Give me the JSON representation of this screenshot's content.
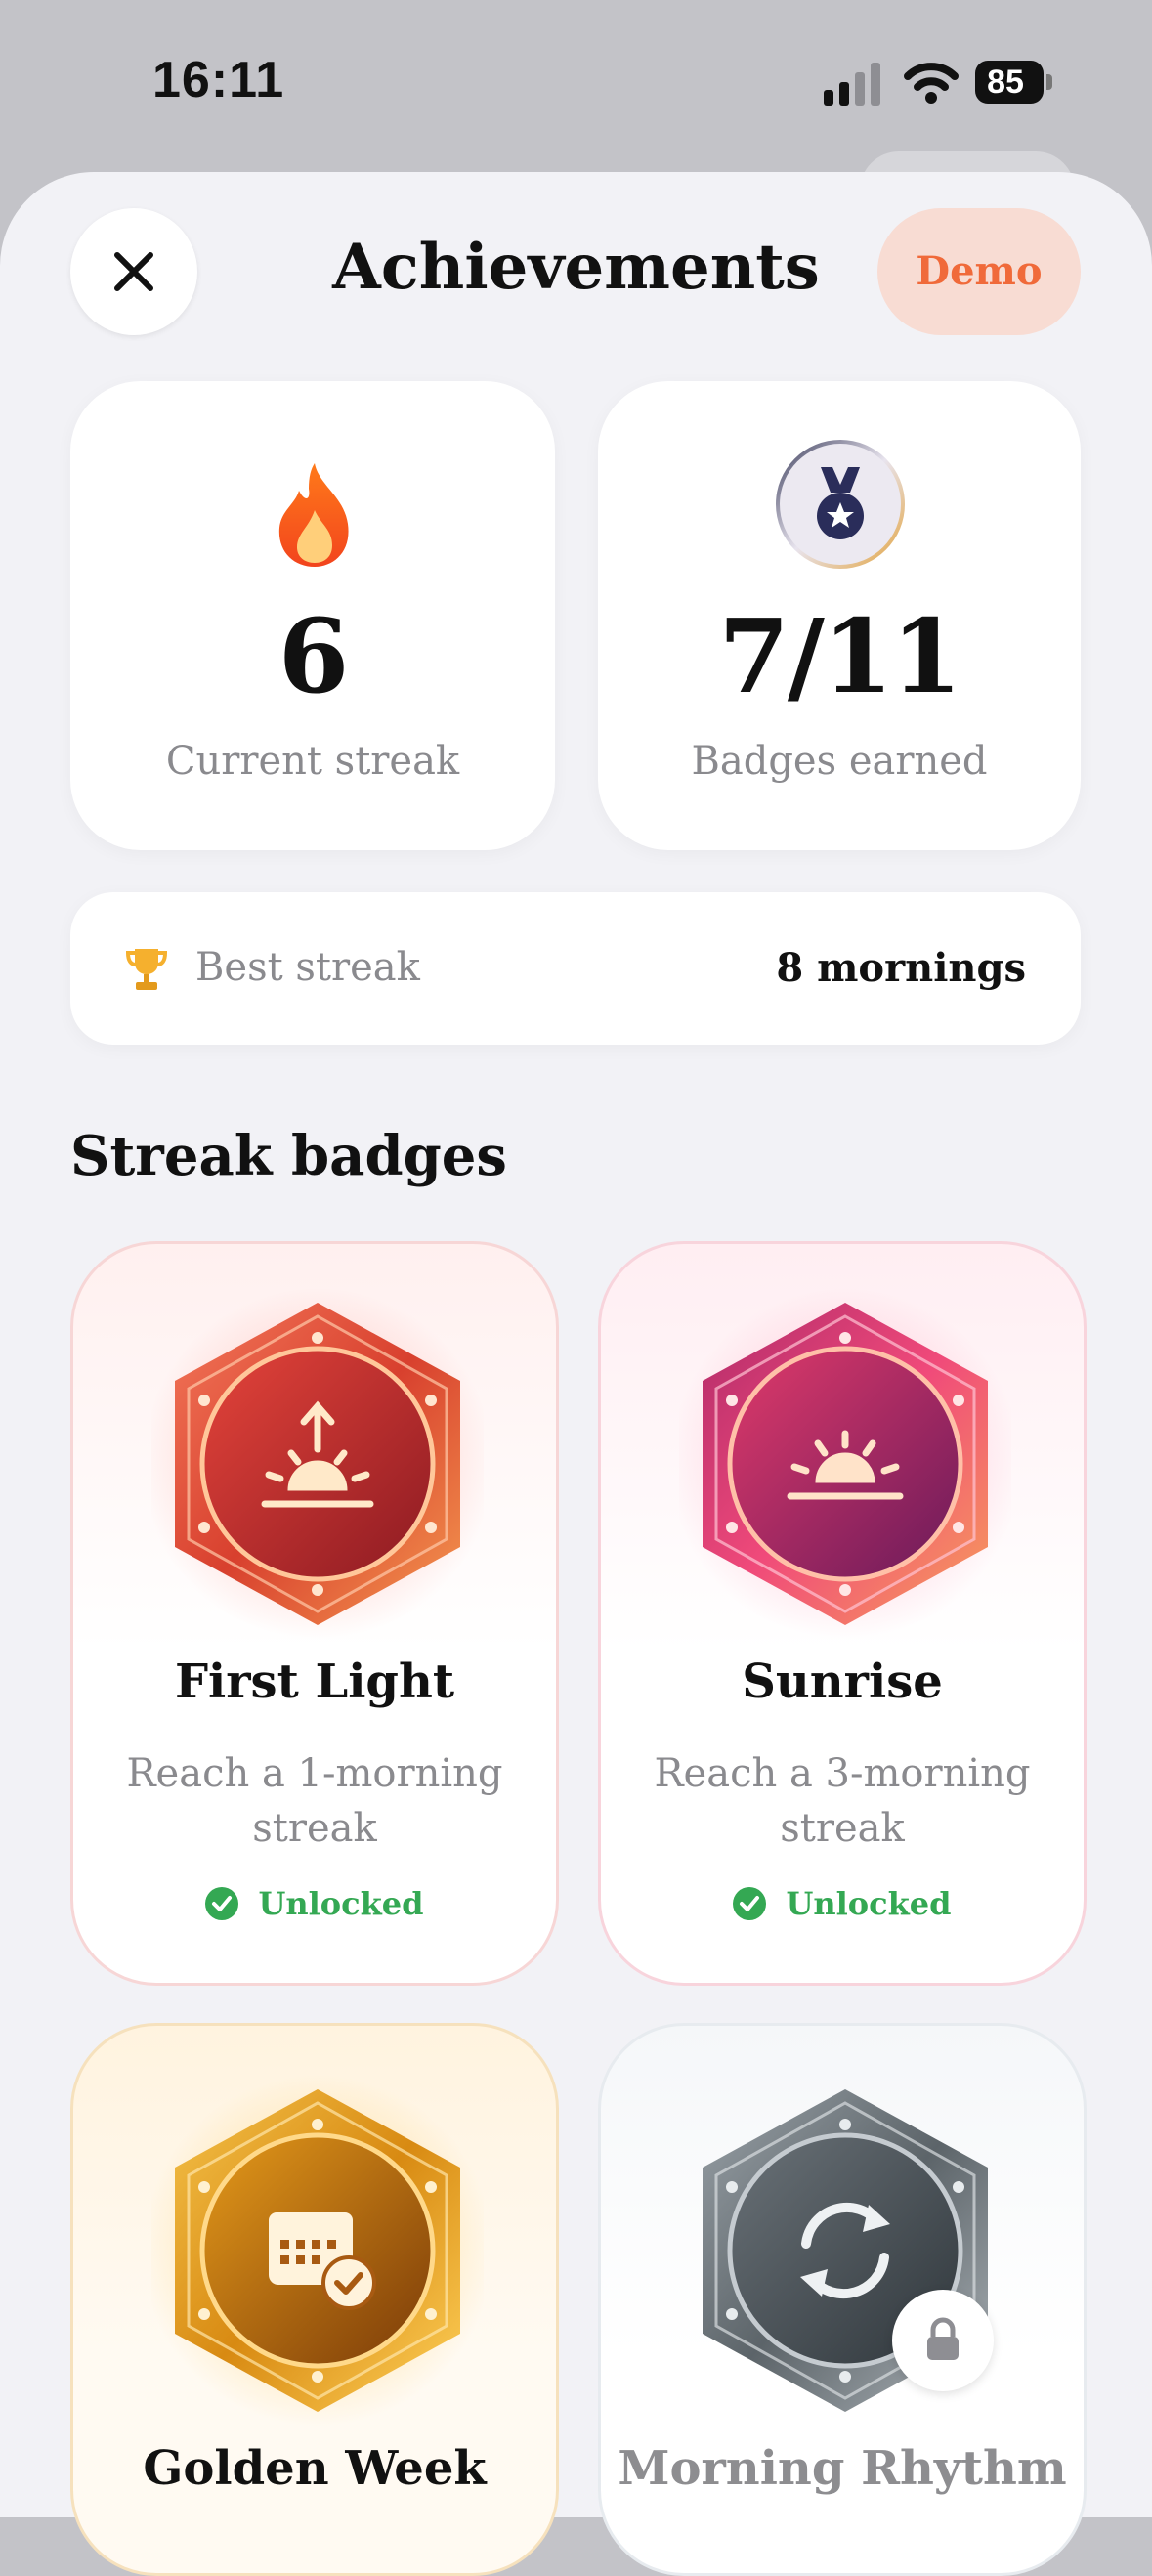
{
  "status_bar": {
    "time": "16:11",
    "battery": "85"
  },
  "header": {
    "title": "Achievements",
    "demo_label": "Demo"
  },
  "stats": {
    "current_streak": {
      "value": "6",
      "label": "Current streak"
    },
    "badges_earned": {
      "value": "7/11",
      "label": "Badges earned"
    }
  },
  "best_streak": {
    "label": "Best streak",
    "value": "8 mornings"
  },
  "section": {
    "title": "Streak badges"
  },
  "badges": [
    {
      "name": "First Light",
      "description": "Reach a 1-morning streak",
      "status": "Unlocked",
      "icon": "sunrise-arrow-icon",
      "color": "#c7342c"
    },
    {
      "name": "Sunrise",
      "description": "Reach a 3-morning streak",
      "status": "Unlocked",
      "icon": "sunrise-icon",
      "color": "#a8246a"
    },
    {
      "name": "Golden Week",
      "icon": "calendar-check-icon",
      "color": "#c9861a"
    },
    {
      "name": "Morning Rhythm",
      "icon": "repeat-icon",
      "color": "#5a6168",
      "locked": true
    }
  ],
  "colors": {
    "accent": "#f06a3a",
    "unlocked": "#34a853",
    "background": "#f2f2f6"
  }
}
